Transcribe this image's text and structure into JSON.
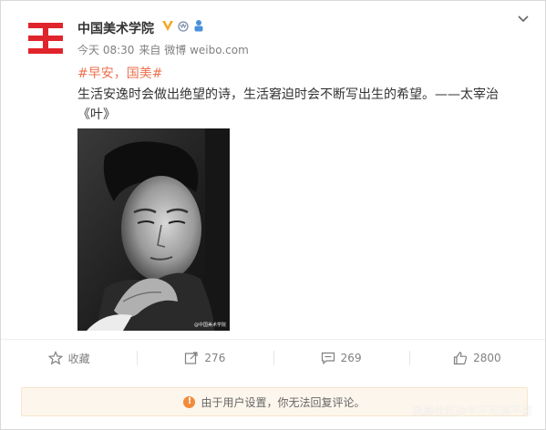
{
  "post": {
    "author_name": "中国美术学院",
    "time": "今天 08:30",
    "source_prefix": "来自",
    "source": "微博 weibo.com",
    "tags": [
      "#早安，国美#"
    ],
    "text": "生活安逸时会做出绝望的诗，生活窘迫时会不断写出生的希望。——太宰治《叶》",
    "photo_caption": "@中国美术学院"
  },
  "actions": {
    "favorite_label": "收藏",
    "repost_count": "276",
    "comment_count": "269",
    "like_count": "2800"
  },
  "notice": {
    "text": "由于用户设置，你无法回复评论。"
  },
  "watermark": "凤凰社区@字不可消不芸",
  "colors": {
    "brand_red": "#e0242b",
    "tag_orange": "#eb7350",
    "verified_gold": "#f5a623",
    "notice_bg": "#fdf6ec",
    "notice_icon": "#f18c3c"
  }
}
